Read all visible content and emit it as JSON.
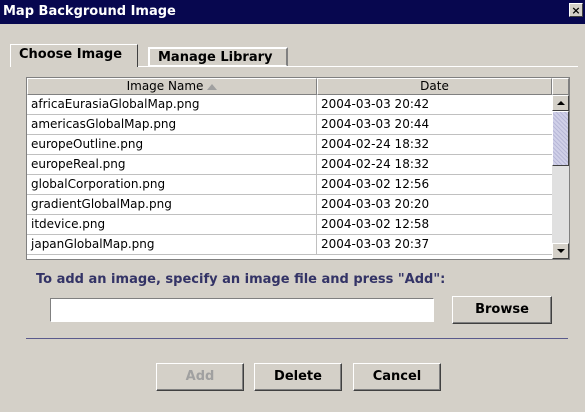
{
  "window": {
    "title": "Map Background Image",
    "close_label": "×"
  },
  "tabs": [
    {
      "label": "Choose Image",
      "active": true
    },
    {
      "label": "Manage Library",
      "active": false
    }
  ],
  "table": {
    "columns": [
      "Image Name",
      "Date"
    ],
    "rows": [
      {
        "name": "africaEurasiaGlobalMap.png",
        "date": "2004-03-03 20:42"
      },
      {
        "name": "americasGlobalMap.png",
        "date": "2004-03-03 20:44"
      },
      {
        "name": "europeOutline.png",
        "date": "2004-02-24 18:32"
      },
      {
        "name": "europeReal.png",
        "date": "2004-02-24 18:32"
      },
      {
        "name": "globalCorporation.png",
        "date": "2004-03-02 12:56"
      },
      {
        "name": "gradientGlobalMap.png",
        "date": "2004-03-03 20:20"
      },
      {
        "name": "itdevice.png",
        "date": "2004-03-02 12:58"
      },
      {
        "name": "japanGlobalMap.png",
        "date": "2004-03-03 20:37"
      }
    ]
  },
  "instruction": "To add an image, specify an image file and press \"Add\":",
  "file_input": {
    "value": "",
    "placeholder": ""
  },
  "buttons": {
    "browse": "Browse",
    "add": "Add",
    "delete": "Delete",
    "cancel": "Cancel"
  },
  "colors": {
    "titlebar": "#07074f",
    "instruction_text": "#333366"
  }
}
